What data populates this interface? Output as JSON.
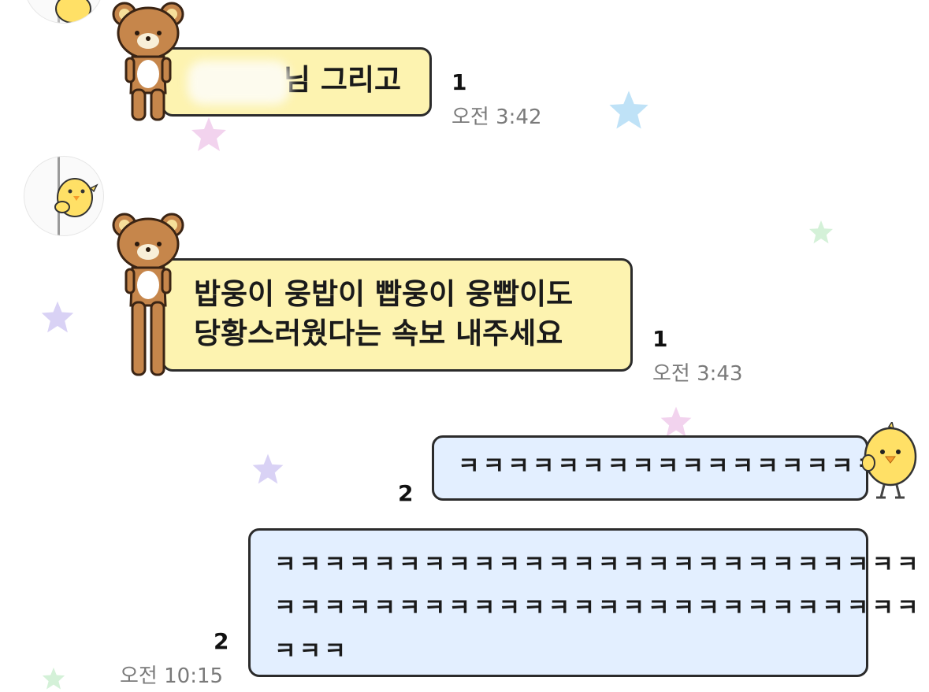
{
  "colors": {
    "incoming_bubble": "#fdf3b0",
    "outgoing_bubble": "#e3efff",
    "bubble_border": "#2b2b2b",
    "time_text": "#7a7a7a",
    "star_blue": "#bfe2f7",
    "star_pink": "#f2d3ee",
    "star_purple": "#d9d2f5",
    "star_green": "#d4f1d8"
  },
  "messages": [
    {
      "direction": "incoming",
      "lines": [
        "님 그리고"
      ],
      "unread": "1",
      "time": "오전 3:42",
      "sticker": "rilakkuma-bear-icon",
      "partially_hidden": true
    },
    {
      "direction": "incoming",
      "lines": [
        "밥웅이 웅밥이 빱웅이 웅빱이도",
        "당황스러웠다는 속보 내주세요"
      ],
      "unread": "1",
      "time": "오전 3:43",
      "sticker": "rilakkuma-bear-icon",
      "avatar": "chick-peeking-avatar"
    },
    {
      "direction": "outgoing",
      "lines": [
        "ㅋㅋㅋㅋㅋㅋㅋㅋㅋㅋㅋㅋㅋㅋㅋㅋㅋ"
      ],
      "unread": "2",
      "sticker": "kiiroitori-chick-icon"
    },
    {
      "direction": "outgoing",
      "lines": [
        "ㅋㅋㅋㅋㅋㅋㅋㅋㅋㅋㅋㅋㅋㅋㅋㅋㅋㅋㅋㅋㅋㅋㅋㅋㅋㅋ",
        "ㅋㅋㅋㅋㅋㅋㅋㅋㅋㅋㅋㅋㅋㅋㅋㅋㅋㅋㅋㅋㅋㅋㅋㅋㅋㅋ",
        "ㅋㅋㅋ"
      ],
      "unread": "2",
      "time": "오전 10:15"
    }
  ]
}
